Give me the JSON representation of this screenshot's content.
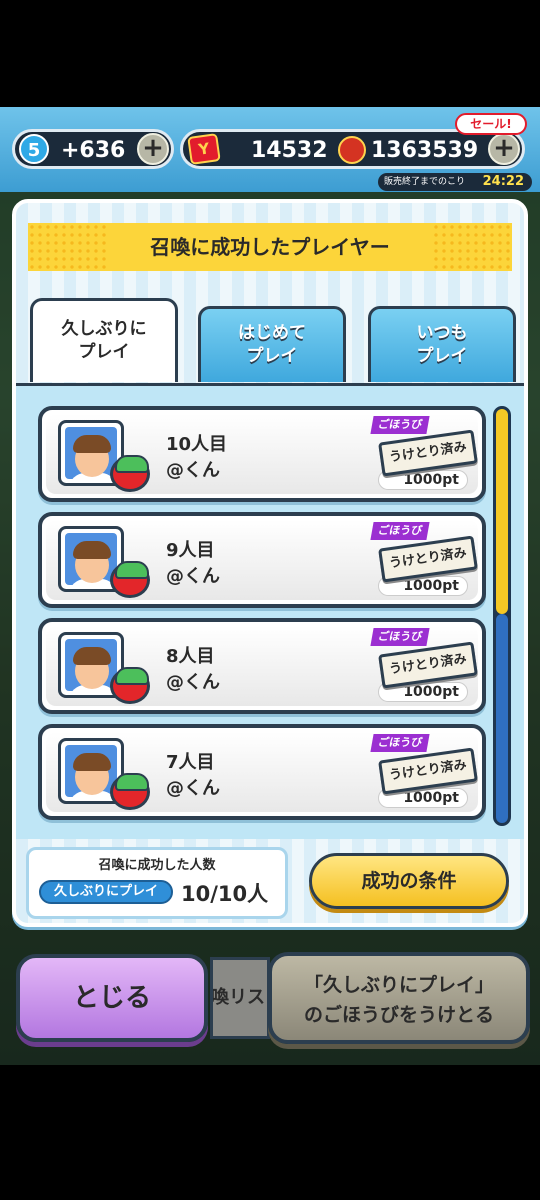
{
  "topbar": {
    "stamina_level": "5",
    "stamina_value": "+636",
    "plus_symbol": "+",
    "ycoin_symbol": "Y",
    "ycoin_value": "14532",
    "money_value": "1363539",
    "sale_label": "セール!",
    "sale_end_label": "販売終了までのこり",
    "sale_end_time": "24:22"
  },
  "modal": {
    "title": "召喚に成功したプレイヤー",
    "tabs": [
      {
        "label": "久しぶりに\nプレイ",
        "active": true
      },
      {
        "label": "はじめて\nプレイ",
        "active": false
      },
      {
        "label": "いつも\nプレイ",
        "active": false
      }
    ],
    "rows": [
      {
        "count": "10人目",
        "name": "@くん",
        "reward_tag": "ごほうび",
        "stamp": "うけとり済み",
        "points": "1000pt"
      },
      {
        "count": "9人目",
        "name": "@くん",
        "reward_tag": "ごほうび",
        "stamp": "うけとり済み",
        "points": "1000pt"
      },
      {
        "count": "8人目",
        "name": "@くん",
        "reward_tag": "ごほうび",
        "stamp": "うけとり済み",
        "points": "1000pt"
      },
      {
        "count": "7人目",
        "name": "@くん",
        "reward_tag": "ごほうび",
        "stamp": "うけとり済み",
        "points": "1000pt"
      }
    ],
    "summary": {
      "title": "召喚に成功した人数",
      "category": "久しぶりにプレイ",
      "value": "10/10人"
    },
    "condition_button": "成功の条件"
  },
  "buttons": {
    "close": "とじる",
    "list_fragment": "喚リス",
    "claim_line1": "「久しぶりにプレイ」",
    "claim_line2": "のごほうびをうけとる"
  },
  "colors": {
    "accent_yellow": "#fcd53a",
    "tab_blue": "#3fa8dd",
    "close_purple": "#b377e0",
    "reward_purple": "#9b2fd1"
  }
}
